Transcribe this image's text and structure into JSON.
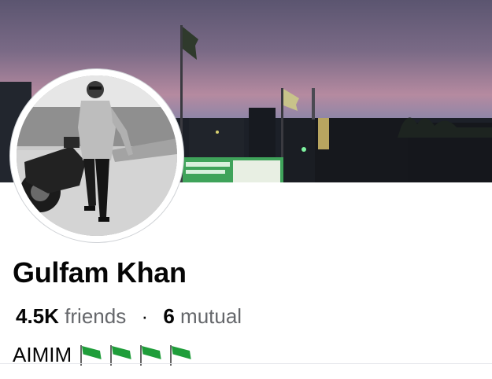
{
  "profile": {
    "name": "Gulfam Khan",
    "friends_count": "4.5K",
    "friends_label": "friends",
    "separator": "·",
    "mutual_count": "6",
    "mutual_label": "mutual",
    "bio_text": "AIMIM",
    "bio_emojis": [
      "flag-icon",
      "flag-icon",
      "flag-icon",
      "flag-icon"
    ]
  },
  "colors": {
    "name_text": "#050505",
    "secondary_text": "#65676b",
    "flag_green": "#1f9d3a"
  }
}
